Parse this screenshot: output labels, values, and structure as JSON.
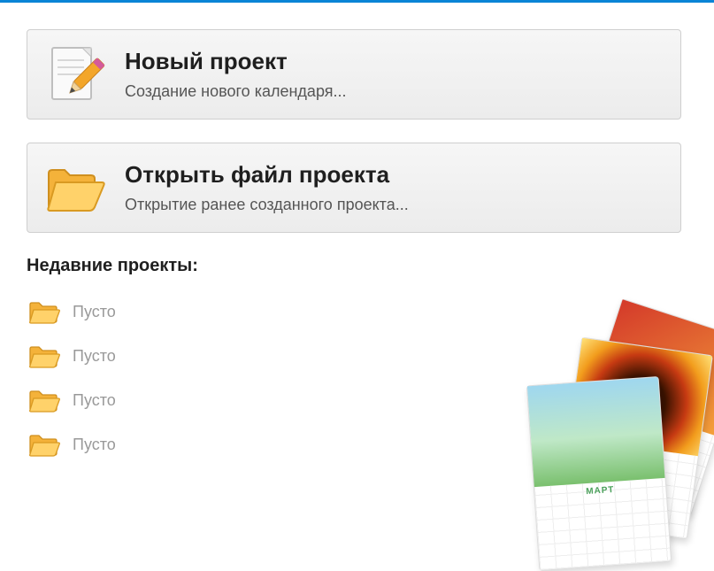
{
  "actions": {
    "new_project": {
      "title": "Новый проект",
      "description": "Создание нового календаря..."
    },
    "open_project": {
      "title": "Открыть файл проекта",
      "description": "Открытие ранее созданного проекта..."
    }
  },
  "recent": {
    "heading": "Недавние проекты:",
    "items": [
      {
        "label": "Пусто"
      },
      {
        "label": "Пусто"
      },
      {
        "label": "Пусто"
      },
      {
        "label": "Пусто"
      }
    ]
  },
  "decor": {
    "calendar_month": "МАРТ"
  }
}
